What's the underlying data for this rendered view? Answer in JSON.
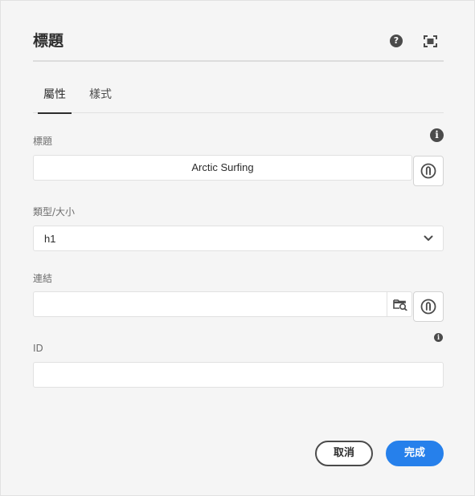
{
  "dialog": {
    "title": "標題",
    "help_icon_glyph": "?",
    "icons": {
      "help": "help-icon",
      "fullscreen": "fullscreen-icon"
    }
  },
  "tabs": [
    {
      "label": "屬性",
      "active": true
    },
    {
      "label": "樣式",
      "active": false
    }
  ],
  "fields": {
    "title": {
      "label": "標題",
      "value": "Arctic Surfing",
      "info_glyph": "i"
    },
    "type_size": {
      "label": "類型/大小",
      "selected": "h1"
    },
    "link": {
      "label": "連結",
      "value": ""
    },
    "id": {
      "label": "ID",
      "value": "",
      "info_glyph": "i"
    }
  },
  "icons": {
    "inherit": "inheritance-icon",
    "browse": "folder-search-icon",
    "chevron": "chevron-down-icon",
    "info": "info-icon"
  },
  "footer": {
    "cancel_label": "取消",
    "done_label": "完成"
  },
  "colors": {
    "accent": "#2680eb",
    "text": "#2c2c2c",
    "icon": "#4b4b4b"
  }
}
